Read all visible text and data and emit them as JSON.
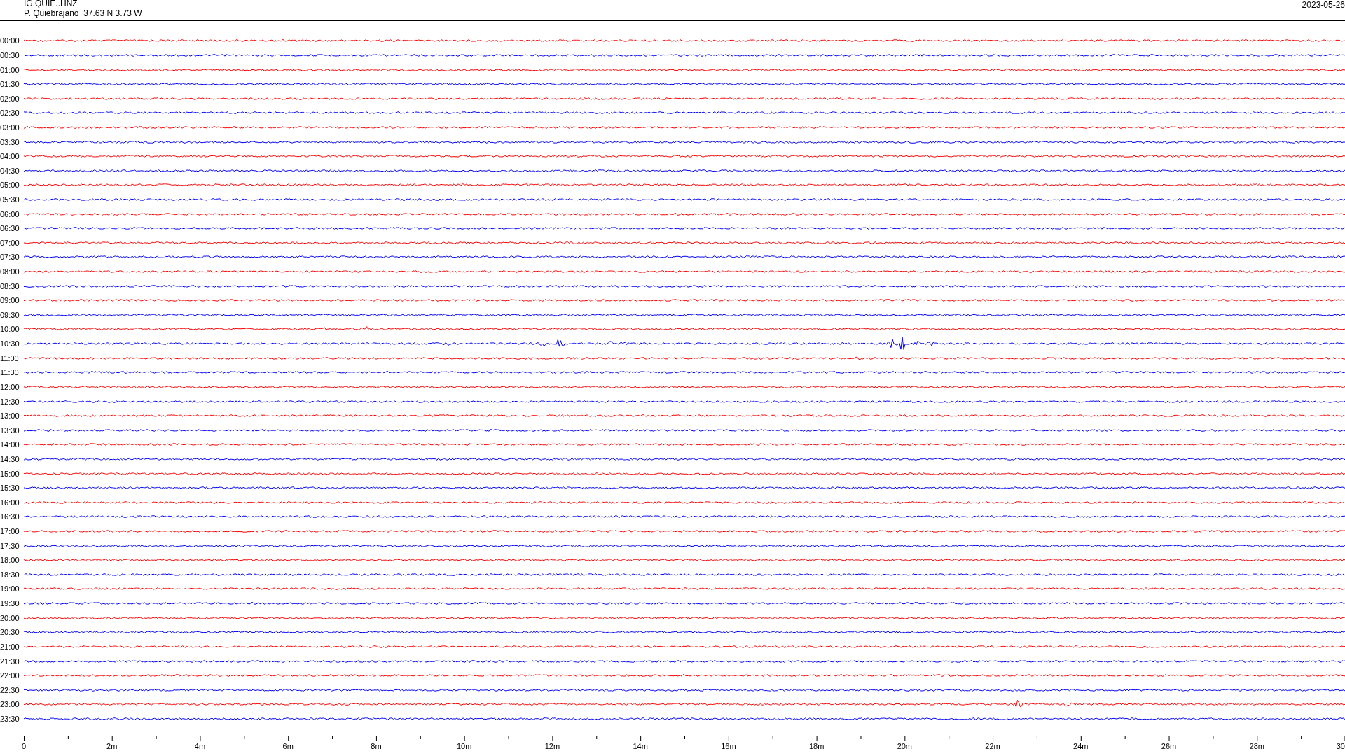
{
  "header": {
    "channel": "IG.QUIE..HNZ",
    "station": "P. Quiebrajano  37.63 N 3.73 W",
    "date": "2023-05-26"
  },
  "rows": [
    {
      "label": "00:00",
      "color": "#ff0000"
    },
    {
      "label": "00:30",
      "color": "#0000ff"
    },
    {
      "label": "01:00",
      "color": "#ff0000"
    },
    {
      "label": "01:30",
      "color": "#0000ff"
    },
    {
      "label": "02:00",
      "color": "#ff0000"
    },
    {
      "label": "02:30",
      "color": "#0000ff"
    },
    {
      "label": "03:00",
      "color": "#ff0000"
    },
    {
      "label": "03:30",
      "color": "#0000ff"
    },
    {
      "label": "04:00",
      "color": "#ff0000"
    },
    {
      "label": "04:30",
      "color": "#0000ff"
    },
    {
      "label": "05:00",
      "color": "#ff0000"
    },
    {
      "label": "05:30",
      "color": "#0000ff"
    },
    {
      "label": "06:00",
      "color": "#ff0000"
    },
    {
      "label": "06:30",
      "color": "#0000ff"
    },
    {
      "label": "07:00",
      "color": "#ff0000"
    },
    {
      "label": "07:30",
      "color": "#0000ff"
    },
    {
      "label": "08:00",
      "color": "#ff0000"
    },
    {
      "label": "08:30",
      "color": "#0000ff"
    },
    {
      "label": "09:00",
      "color": "#ff0000"
    },
    {
      "label": "09:30",
      "color": "#0000ff"
    },
    {
      "label": "10:00",
      "color": "#ff0000"
    },
    {
      "label": "10:30",
      "color": "#0000ff"
    },
    {
      "label": "11:00",
      "color": "#ff0000"
    },
    {
      "label": "11:30",
      "color": "#0000ff"
    },
    {
      "label": "12:00",
      "color": "#ff0000"
    },
    {
      "label": "12:30",
      "color": "#0000ff"
    },
    {
      "label": "13:00",
      "color": "#ff0000"
    },
    {
      "label": "13:30",
      "color": "#0000ff"
    },
    {
      "label": "14:00",
      "color": "#ff0000"
    },
    {
      "label": "14:30",
      "color": "#0000ff"
    },
    {
      "label": "15:00",
      "color": "#ff0000"
    },
    {
      "label": "15:30",
      "color": "#0000ff"
    },
    {
      "label": "16:00",
      "color": "#ff0000"
    },
    {
      "label": "16:30",
      "color": "#0000ff"
    },
    {
      "label": "17:00",
      "color": "#ff0000"
    },
    {
      "label": "17:30",
      "color": "#0000ff"
    },
    {
      "label": "18:00",
      "color": "#ff0000"
    },
    {
      "label": "18:30",
      "color": "#0000ff"
    },
    {
      "label": "19:00",
      "color": "#ff0000"
    },
    {
      "label": "19:30",
      "color": "#0000ff"
    },
    {
      "label": "20:00",
      "color": "#ff0000"
    },
    {
      "label": "20:30",
      "color": "#0000ff"
    },
    {
      "label": "21:00",
      "color": "#ff0000"
    },
    {
      "label": "21:30",
      "color": "#0000ff"
    },
    {
      "label": "22:00",
      "color": "#ff0000"
    },
    {
      "label": "22:30",
      "color": "#0000ff"
    },
    {
      "label": "23:00",
      "color": "#ff0000"
    },
    {
      "label": "23:30",
      "color": "#0000ff"
    }
  ],
  "x_axis": {
    "labels": [
      "0",
      "2m",
      "4m",
      "6m",
      "8m",
      "10m",
      "12m",
      "14m",
      "16m",
      "18m",
      "20m",
      "22m",
      "24m",
      "26m",
      "28m",
      "30"
    ]
  }
}
